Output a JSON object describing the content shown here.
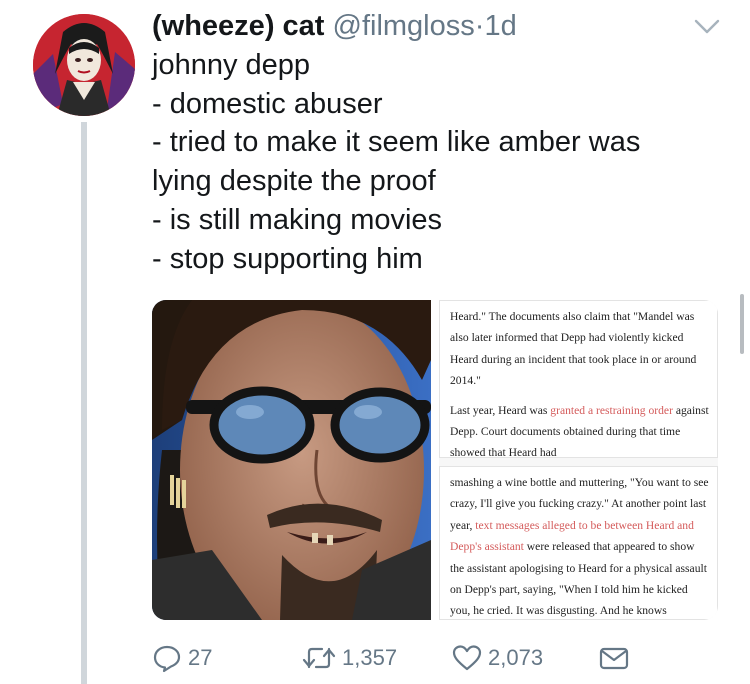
{
  "tweet": {
    "display_name": "(wheeze) cat",
    "handle": "@filmgloss",
    "separator": "·",
    "time": "1d",
    "lines": [
      "johnny depp",
      "- domestic abuser",
      "- tried to make it seem like amber was",
      "lying despite the proof",
      "- is still making movies",
      "- stop supporting him"
    ]
  },
  "article_clip_1": {
    "p1": "Heard.\" The documents also claim that \"Mandel was also later informed that Depp had violently kicked Heard during an incident that took place in or around 2014.\"",
    "p2_a": "Last year, Heard was ",
    "p2_link": "granted a restraining order",
    "p2_b": " against Depp. Court documents obtained during that time showed that Heard had"
  },
  "article_clip_2": {
    "p1_a": "smashing a wine bottle and muttering, \"You want to see crazy, I'll give you fucking crazy.\" At another point last year, ",
    "p1_link": "text messages alleged to be between Heard and Depp's assistant",
    "p1_b": " were released that appeared to show the assistant apologising to Heard for a physical assault on Depp's part, saying, \"When I told him he kicked you, he cried. It was disgusting. And he knows"
  },
  "actions": {
    "reply_count": "27",
    "retweet_count": "1,357",
    "like_count": "2,073",
    "icons": [
      "reply-icon",
      "retweet-icon",
      "heart-icon",
      "message-icon"
    ]
  },
  "colors": {
    "muted": "#657786",
    "link_red": "#d45b5b",
    "thread_line": "#d0d6db"
  }
}
